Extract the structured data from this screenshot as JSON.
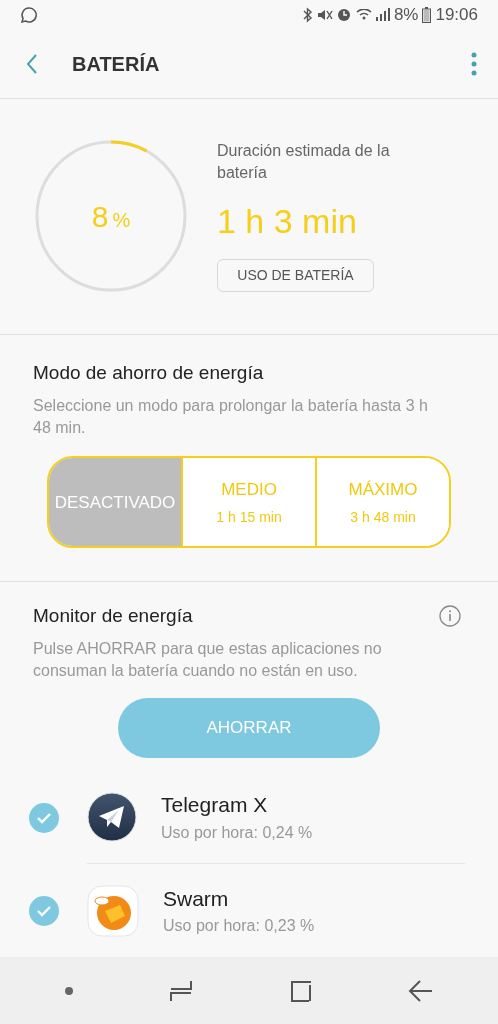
{
  "status_bar": {
    "battery_text": "8%",
    "time": "19:06"
  },
  "toolbar": {
    "title": "BATERÍA"
  },
  "battery": {
    "level": 0.08,
    "percent": "8",
    "percent_sign": "%",
    "estimate_label": "Duración estimada de la batería",
    "estimate": "1 h 3 min",
    "usage_button": "USO DE BATERÍA"
  },
  "power_saving": {
    "title": "Modo de ahorro de energía",
    "description": "Seleccione un modo para prolongar la batería hasta 3 h 48 min.",
    "modes": [
      {
        "label": "DESACTIVADO",
        "selected": true
      },
      {
        "label": "MEDIO",
        "time": "1 h 15 min",
        "selected": false
      },
      {
        "label": "MÁXIMO",
        "time": "3 h 48 min",
        "selected": false
      }
    ]
  },
  "monitor": {
    "title": "Monitor de energía",
    "description": "Pulse AHORRAR para que estas aplicaciones no consuman la batería cuando no están en uso.",
    "save_button": "AHORRAR",
    "apps": [
      {
        "kind": "telegram",
        "name": "Telegram X",
        "usage": "Uso por hora: 0,24 %",
        "checked": true
      },
      {
        "kind": "swarm",
        "name": "Swarm",
        "usage": "Uso por hora: 0,23 %",
        "checked": true
      }
    ]
  }
}
